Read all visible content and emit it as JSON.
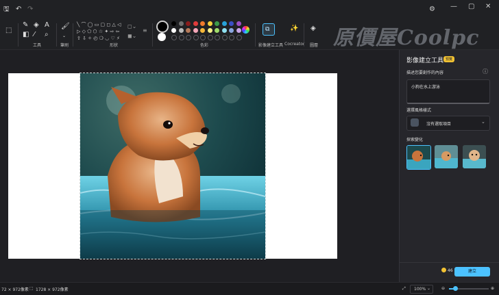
{
  "ribbon": {
    "groups": {
      "tools": "工具",
      "brushes": "筆刷",
      "shapes": "形狀",
      "colors": "色彩",
      "image_creator": "影像建立工具",
      "cocreator": "Cocreator",
      "layers": "圖層"
    }
  },
  "watermark": "原價屋Coolpc",
  "palette": {
    "row1": [
      "#000000",
      "#6e6e6e",
      "#8a1c1c",
      "#e03b3b",
      "#f07a2c",
      "#f5d13b",
      "#3c9a49",
      "#27a1d8",
      "#3a4fc4",
      "#9b4fc4"
    ],
    "row2": [
      "#ffffff",
      "#bdbdbd",
      "#b57a5a",
      "#f3a6b8",
      "#f5b83b",
      "#f5ef8a",
      "#9fdc6a",
      "#8fe0f0",
      "#8aa6e0",
      "#c9a6e8"
    ],
    "primary": "#000000",
    "secondary": "#ffffff"
  },
  "panel": {
    "title": "影像建立工具",
    "badge": "預覽",
    "prompt_label": "描述您要創作的內容",
    "prompt_value": "小狗在水上游泳",
    "style_label": "選擇風格樣式",
    "style_value": "沒有選取項目",
    "explore_label": "探索變化",
    "credits": "46",
    "create_button": "建立"
  },
  "status": {
    "left": "72 × 972像素",
    "selection": "1728 × 972像素",
    "zoom": "100%"
  }
}
